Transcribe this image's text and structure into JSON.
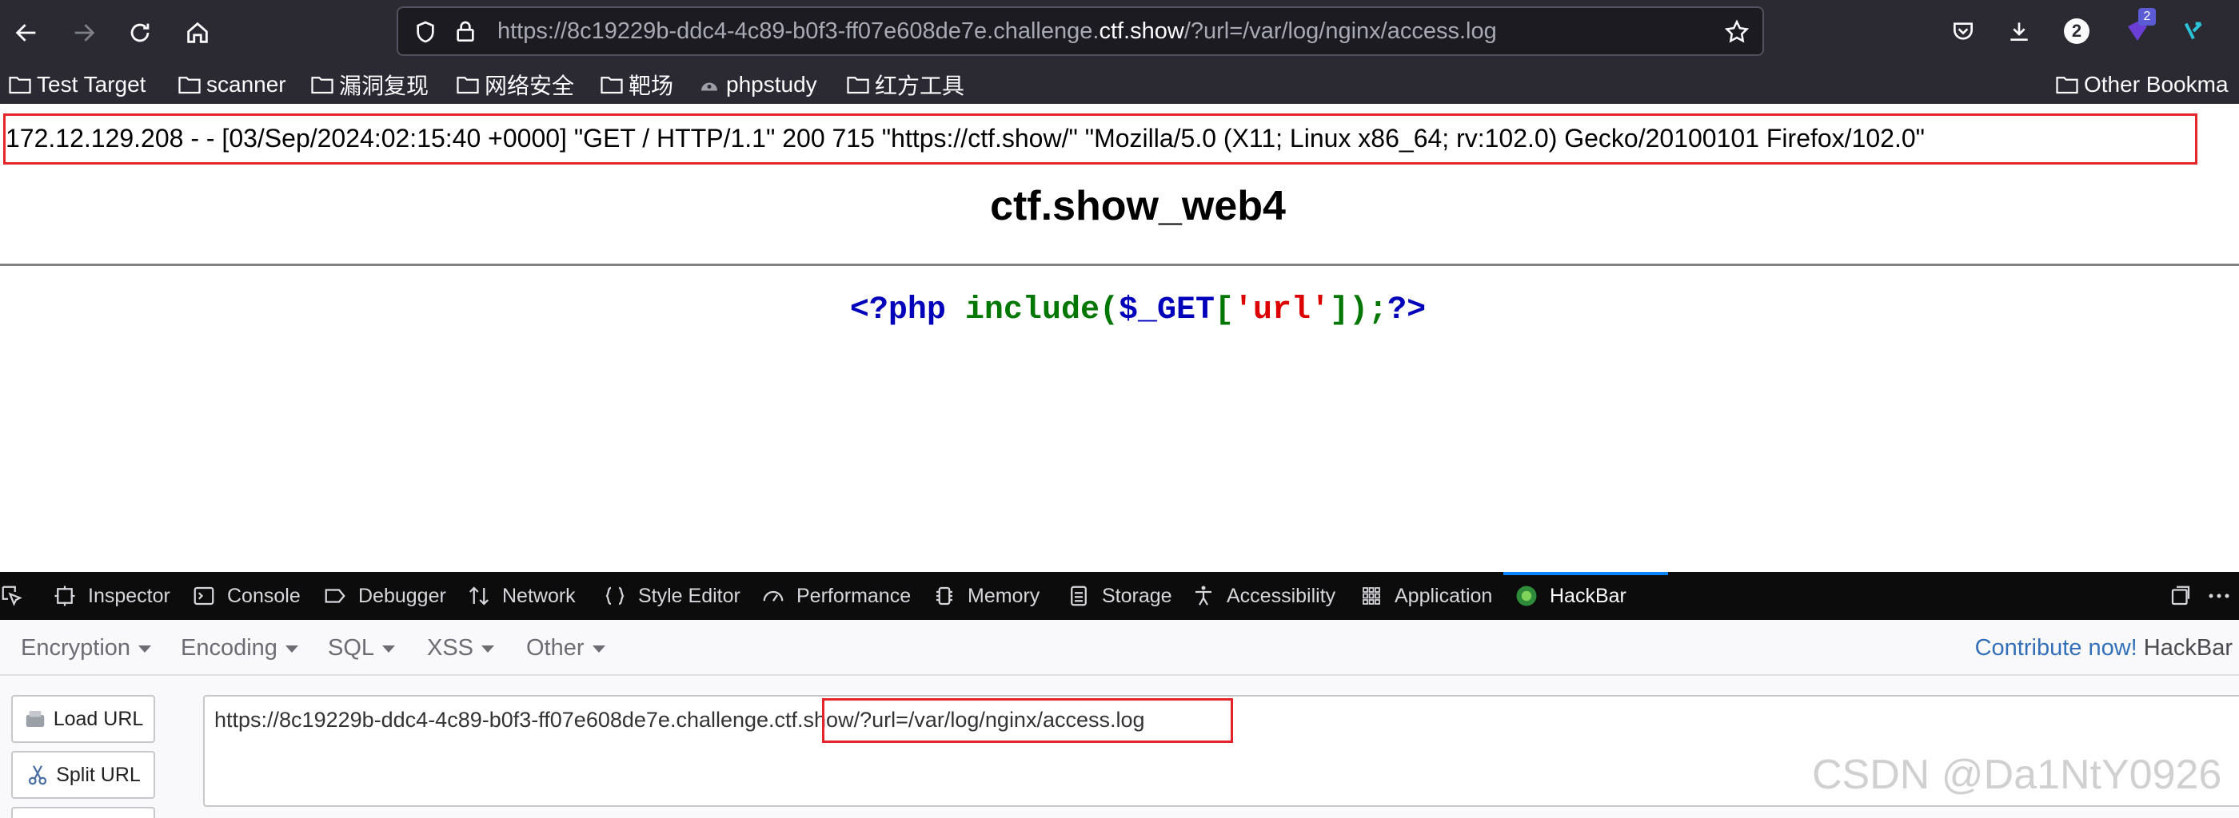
{
  "browser": {
    "url_prefix": "https://8c19229b-ddc4-4c89-b0f3-ff07e608de7e.challenge.",
    "url_domain": "ctf.show",
    "url_suffix": "/?url=/var/log/nginx/access.log",
    "downloads_badge": "2",
    "extension_badge": "2"
  },
  "bookmarks": {
    "items": [
      {
        "label": "Test Target",
        "icon": "folder-icon"
      },
      {
        "label": "scanner",
        "icon": "folder-icon"
      },
      {
        "label": "漏洞复现",
        "icon": "folder-icon"
      },
      {
        "label": "网络安全",
        "icon": "folder-icon"
      },
      {
        "label": "靶场",
        "icon": "folder-icon"
      },
      {
        "label": "phpstudy",
        "icon": "site-icon"
      },
      {
        "label": "红方工具",
        "icon": "folder-icon"
      }
    ],
    "other": "Other Bookma"
  },
  "page": {
    "log_line": "172.12.129.208 - - [03/Sep/2024:02:15:40 +0000] \"GET / HTTP/1.1\" 200 715 \"https://ctf.show/\" \"Mozilla/5.0 (X11; Linux x86_64; rv:102.0) Gecko/20100101 Firefox/102.0\"",
    "title": "ctf.show_web4",
    "code": {
      "open": "<?php",
      "include": "include",
      "paren_open": "(",
      "var": "$_GET",
      "bracket_open": "[",
      "key": "'url'",
      "bracket_close": "]",
      "paren_close": ")",
      "semicolon": ";",
      "close": "?>"
    },
    "code_colors": {
      "php_tag": "#0000bb",
      "keyword": "#007700",
      "string": "#dd0000"
    }
  },
  "devtools": {
    "tabs": [
      {
        "label": "Inspector",
        "icon": "inspector-icon"
      },
      {
        "label": "Console",
        "icon": "console-icon"
      },
      {
        "label": "Debugger",
        "icon": "debugger-icon"
      },
      {
        "label": "Network",
        "icon": "network-icon"
      },
      {
        "label": "Style Editor",
        "icon": "style-editor-icon"
      },
      {
        "label": "Performance",
        "icon": "performance-icon"
      },
      {
        "label": "Memory",
        "icon": "memory-icon"
      },
      {
        "label": "Storage",
        "icon": "storage-icon"
      },
      {
        "label": "Accessibility",
        "icon": "accessibility-icon"
      },
      {
        "label": "Application",
        "icon": "application-icon"
      },
      {
        "label": "HackBar",
        "icon": "hackbar-icon"
      }
    ],
    "active_tab": "HackBar"
  },
  "hackbar": {
    "menu": [
      "Encryption",
      "Encoding",
      "SQL",
      "XSS",
      "Other"
    ],
    "contribute_link": "Contribute now!",
    "brand": "HackBar",
    "load_url": "Load URL",
    "split_url": "Split URL",
    "url_value": "https://8c19229b-ddc4-4c89-b0f3-ff07e608de7e.challenge.ctf.show/?url=/var/log/nginx/access.log"
  },
  "watermark": "CSDN @Da1NtY0926"
}
